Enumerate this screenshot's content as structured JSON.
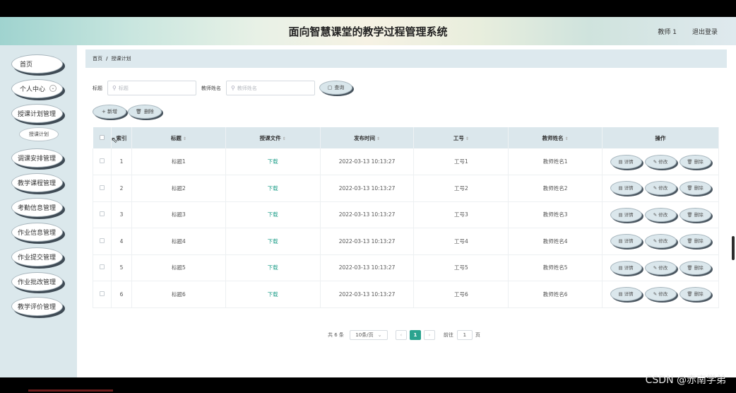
{
  "header": {
    "title": "面向智慧课堂的教学过程管理系统",
    "user": "教师 1",
    "logout": "退出登录"
  },
  "sidebar": {
    "items": [
      {
        "label": "首页"
      },
      {
        "label": "个人中心"
      },
      {
        "label": "授课计划管理"
      },
      {
        "label": "授课计划"
      },
      {
        "label": "调课安排管理"
      },
      {
        "label": "教学课程管理"
      },
      {
        "label": "考勤信息管理"
      },
      {
        "label": "作业信息管理"
      },
      {
        "label": "作业提交管理"
      },
      {
        "label": "作业批改管理"
      },
      {
        "label": "教学评价管理"
      }
    ]
  },
  "breadcrumb": {
    "home": "首页",
    "separator": "/",
    "current": "授课计划"
  },
  "search": {
    "title_label": "标题",
    "title_placeholder": "标题",
    "teacher_label": "教师姓名",
    "teacher_placeholder": "教师姓名",
    "query_button": "查询"
  },
  "toolbar": {
    "add": "+ 新增",
    "delete": "删除"
  },
  "table": {
    "headers": [
      "索引",
      "标题",
      "授课文件",
      "发布时间",
      "工号",
      "教师姓名",
      "操作"
    ],
    "rows": [
      {
        "idx": "1",
        "title": "标题1",
        "file": "下载",
        "time": "2022-03-13 10:13:27",
        "id": "工号1",
        "teacher": "教师姓名1"
      },
      {
        "idx": "2",
        "title": "标题2",
        "file": "下载",
        "time": "2022-03-13 10:13:27",
        "id": "工号2",
        "teacher": "教师姓名2"
      },
      {
        "idx": "3",
        "title": "标题3",
        "file": "下载",
        "time": "2022-03-13 10:13:27",
        "id": "工号3",
        "teacher": "教师姓名3"
      },
      {
        "idx": "4",
        "title": "标题4",
        "file": "下载",
        "time": "2022-03-13 10:13:27",
        "id": "工号4",
        "teacher": "教师姓名4"
      },
      {
        "idx": "5",
        "title": "标题5",
        "file": "下载",
        "time": "2022-03-13 10:13:27",
        "id": "工号5",
        "teacher": "教师姓名5"
      },
      {
        "idx": "6",
        "title": "标题6",
        "file": "下载",
        "time": "2022-03-13 10:13:27",
        "id": "工号6",
        "teacher": "教师姓名6"
      }
    ],
    "actions": {
      "detail": "详情",
      "edit": "修改",
      "delete": "删除"
    }
  },
  "pager": {
    "total": "共 6 条",
    "page_size": "10条/页",
    "current_page": "1",
    "goto_label": "前往",
    "goto_value": "1",
    "page_unit": "页"
  },
  "watermark": "CSDN @赤南学弟"
}
